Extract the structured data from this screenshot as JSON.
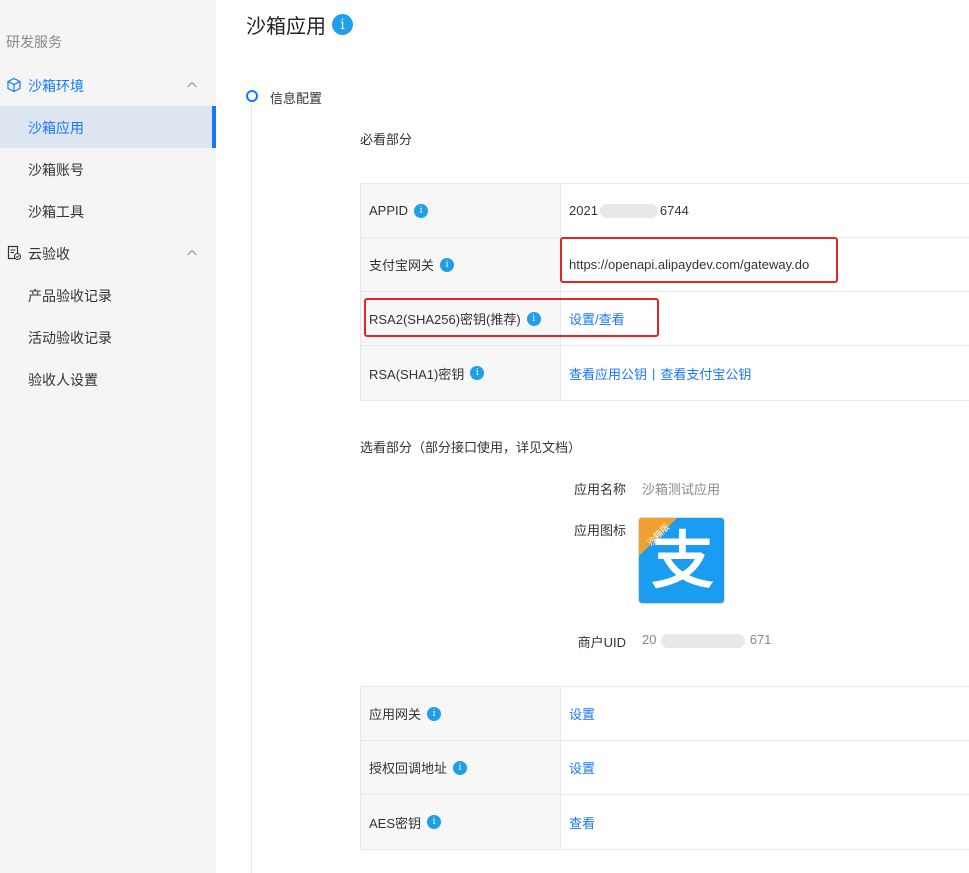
{
  "sidebar": {
    "section_title": "研发服务",
    "group_sandbox": {
      "label": "沙箱环境",
      "icon": "cube-icon"
    },
    "items_sandbox": [
      {
        "label": "沙箱应用",
        "active": true
      },
      {
        "label": "沙箱账号",
        "active": false
      },
      {
        "label": "沙箱工具",
        "active": false
      }
    ],
    "group_acceptance": {
      "label": "云验收",
      "icon": "document-check-icon"
    },
    "items_acceptance": [
      {
        "label": "产品验收记录"
      },
      {
        "label": "活动验收记录"
      },
      {
        "label": "验收人设置"
      }
    ]
  },
  "main": {
    "title": "沙箱应用",
    "step_title": "信息配置",
    "required_title": "必看部分",
    "required_rows": [
      {
        "label": "APPID",
        "value_prefix": "2021",
        "value_suffix": "6744"
      },
      {
        "label": "支付宝网关",
        "value": "https://openapi.alipaydev.com/gateway.do"
      },
      {
        "label": "RSA2(SHA256)密钥(推荐)",
        "link": "设置/查看"
      },
      {
        "label": "RSA(SHA1)密钥",
        "link1": "查看应用公钥",
        "separator": "|",
        "link2": "查看支付宝公钥"
      }
    ],
    "optional_title": "选看部分（部分接口使用，详见文档）",
    "app_name_label": "应用名称",
    "app_name_value": "沙箱测试应用",
    "app_icon_label": "应用图标",
    "app_icon_badge": "沙箱版",
    "app_icon_glyph": "支",
    "merchant_uid_label": "商户UID",
    "merchant_uid_prefix": "20",
    "merchant_uid_suffix": "671",
    "optional_rows": [
      {
        "label": "应用网关",
        "link": "设置"
      },
      {
        "label": "授权回调地址",
        "link": "设置"
      },
      {
        "label": "AES密钥",
        "link": "查看"
      }
    ],
    "info_glyph": "i"
  },
  "colors": {
    "accent": "#1677ff",
    "highlight": "#e0262b",
    "alipay_blue": "#1a9df0",
    "badge_orange": "#f0a030"
  }
}
